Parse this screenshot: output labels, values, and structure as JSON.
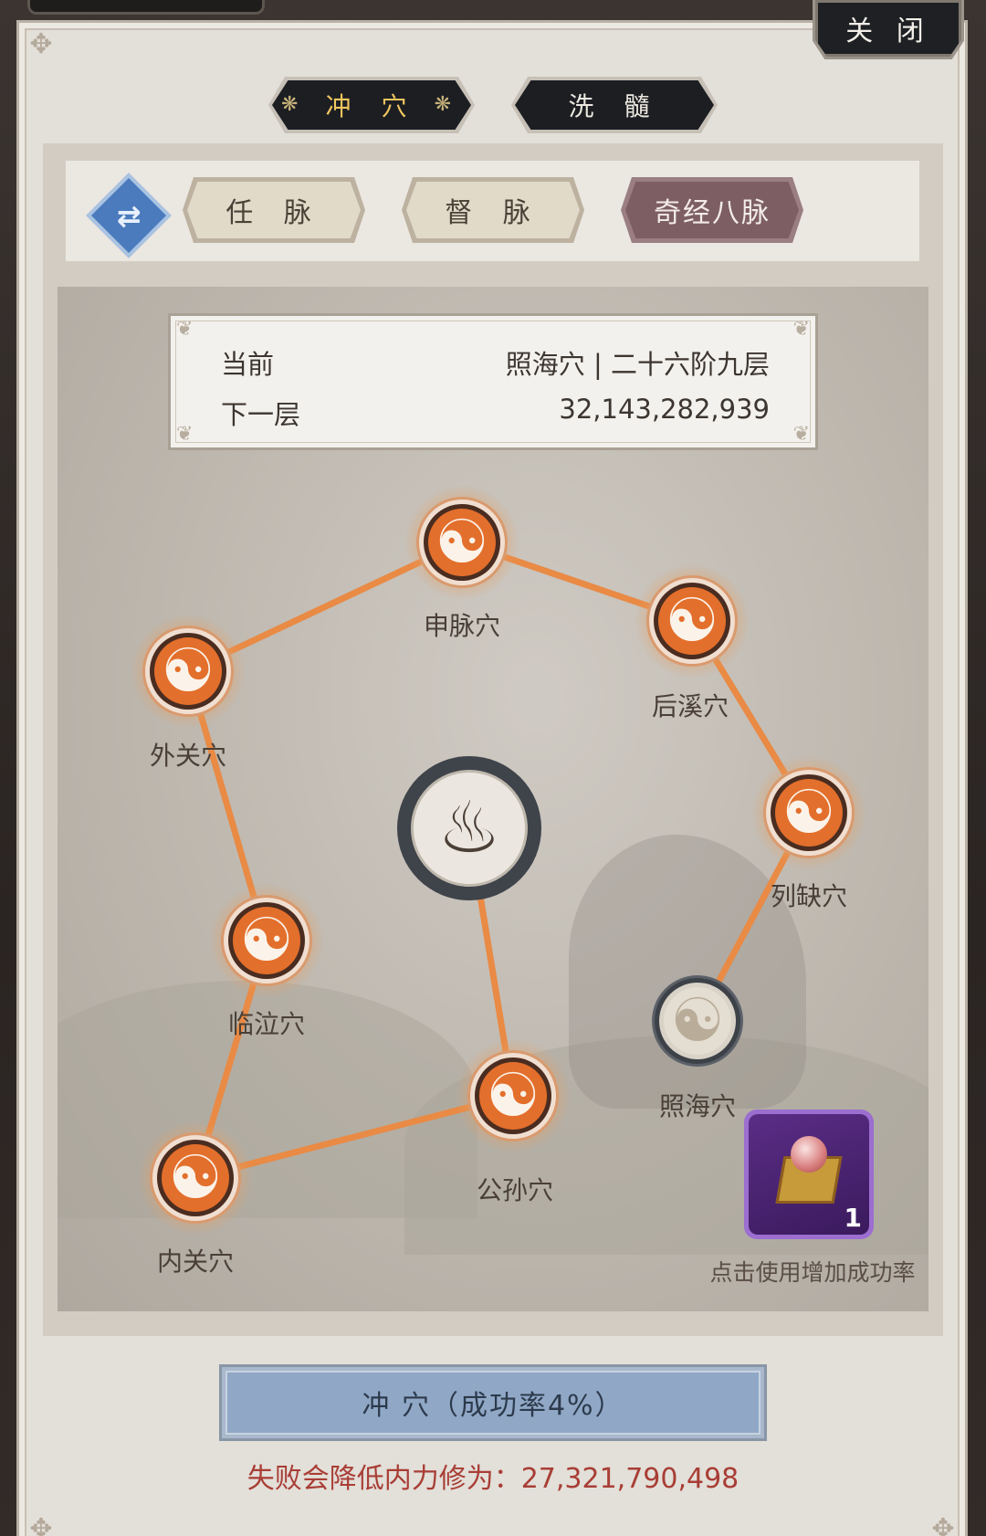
{
  "header": {
    "close_label": "关 闭"
  },
  "main_tabs": [
    {
      "label": "冲 穴",
      "active": true
    },
    {
      "label": "洗 髓",
      "active": false
    }
  ],
  "sub_tabs": [
    {
      "label": "任 脉",
      "active": false
    },
    {
      "label": "督 脉",
      "active": false
    },
    {
      "label": "奇经八脉",
      "active": true
    }
  ],
  "info": {
    "current_label": "当前",
    "current_value": "照海穴 | 二十六阶九层",
    "next_label": "下一层",
    "next_value": "32,143,282,939"
  },
  "acupoints": [
    {
      "name": "申脉穴",
      "state": "unlocked"
    },
    {
      "name": "后溪穴",
      "state": "unlocked"
    },
    {
      "name": "外关穴",
      "state": "unlocked"
    },
    {
      "name": "列缺穴",
      "state": "unlocked"
    },
    {
      "name": "临泣穴",
      "state": "unlocked"
    },
    {
      "name": "照海穴",
      "state": "locked"
    },
    {
      "name": "公孙穴",
      "state": "unlocked"
    },
    {
      "name": "内关穴",
      "state": "unlocked"
    }
  ],
  "item": {
    "count": "1",
    "hint": "点击使用增加成功率"
  },
  "action": {
    "button_label": "冲 穴（成功率4%）",
    "fail_text": "失败会降低内力修为：27,321,790,498"
  },
  "colors": {
    "accent_orange": "#e36f2c",
    "line_orange": "#e98a45",
    "active_subtab": "#7d5e63",
    "button_blue": "#90a8c6",
    "warning_red": "#a83e35"
  }
}
